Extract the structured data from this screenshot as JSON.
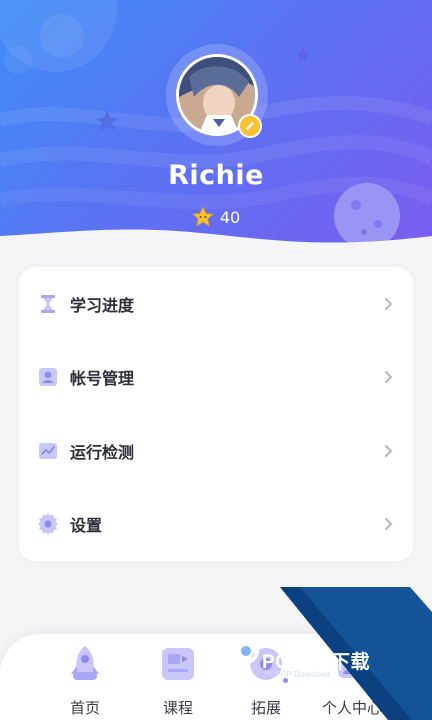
{
  "profile": {
    "name": "Richie",
    "stars": "40"
  },
  "menu": [
    {
      "label": "学习进度",
      "icon": "hourglass-icon"
    },
    {
      "label": "帐号管理",
      "icon": "account-icon"
    },
    {
      "label": "运行检测",
      "icon": "chart-icon"
    },
    {
      "label": "设置",
      "icon": "gear-icon"
    }
  ],
  "tabs": [
    {
      "label": "首页",
      "icon": "rocket-icon"
    },
    {
      "label": "课程",
      "icon": "course-icon"
    },
    {
      "label": "拓展",
      "icon": "extend-icon"
    },
    {
      "label": "个人中心",
      "icon": "profile-icon"
    }
  ],
  "watermark": {
    "brand": "PCPOP下载",
    "sub": "PCPOP Download"
  },
  "colors": {
    "header_start": "#3e8df7",
    "header_end": "#7d5cf0",
    "icon_accent": "#a9a6f5",
    "star_yellow": "#f8c234"
  }
}
